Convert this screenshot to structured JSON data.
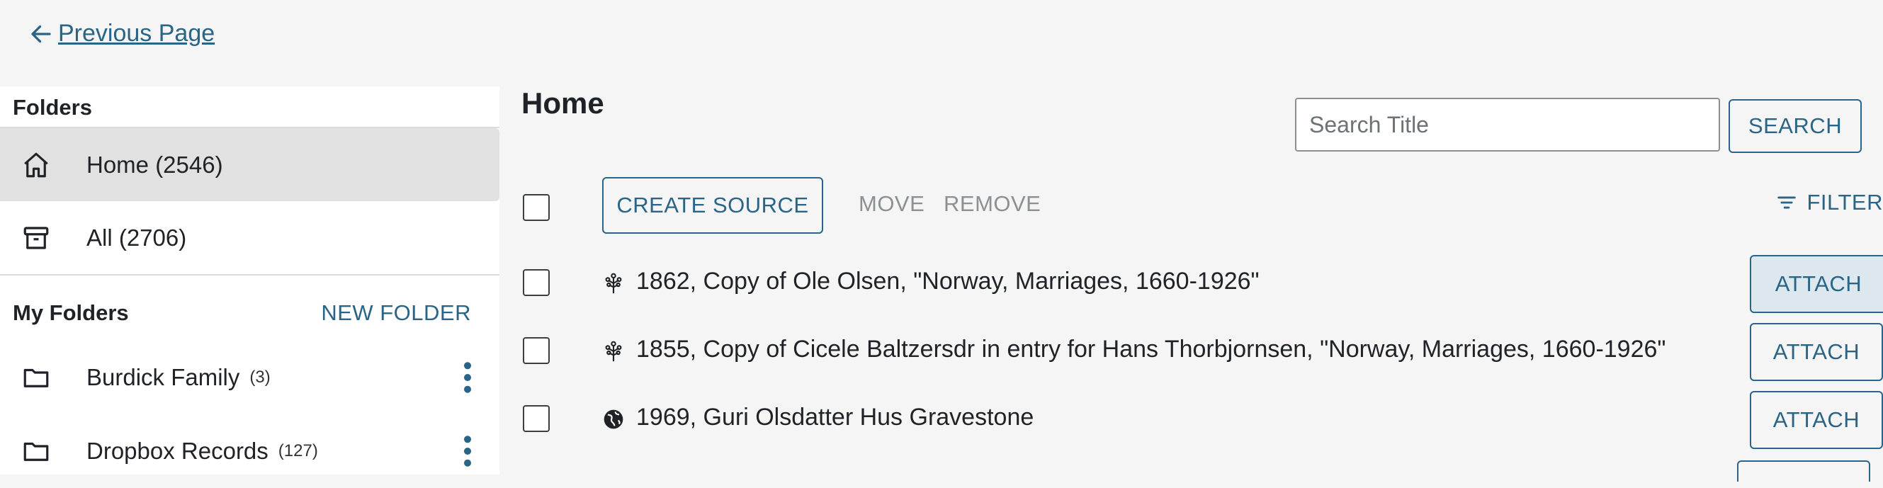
{
  "nav": {
    "previous_label": "Previous Page"
  },
  "sidebar": {
    "heading": "Folders",
    "items": [
      {
        "label": "Home (2546)",
        "icon": "home-icon",
        "active": true
      },
      {
        "label": "All (2706)",
        "icon": "archive-icon",
        "active": false
      }
    ],
    "my_folders_heading": "My Folders",
    "new_folder_label": "NEW FOLDER",
    "folders": [
      {
        "name": "Burdick Family",
        "count": "(3)"
      },
      {
        "name": "Dropbox Records",
        "count": "(127)"
      }
    ]
  },
  "main": {
    "title": "Home",
    "search": {
      "placeholder": "Search Title",
      "button_label": "SEARCH"
    },
    "toolbar": {
      "create_label": "CREATE SOURCE",
      "move_label": "MOVE",
      "remove_label": "REMOVE",
      "filter_label": "FILTER"
    },
    "rows": [
      {
        "title": "1862, Copy of Ole Olsen, \"Norway, Marriages, 1660-1926\"",
        "icon": "tree-icon",
        "attach_label": "ATTACH"
      },
      {
        "title": "1855, Copy of Cicele Baltzersdr in entry for Hans Thorbjornsen, \"Norway, Marriages, 1660-1926\"",
        "icon": "tree-icon",
        "attach_label": "ATTACH"
      },
      {
        "title": "1969, Guri Olsdatter Hus Gravestone",
        "icon": "globe-icon",
        "attach_label": "ATTACH"
      }
    ]
  },
  "colors": {
    "accent": "#2a6486",
    "background": "#f4f5f4",
    "active_item": "#e0e1e0"
  }
}
